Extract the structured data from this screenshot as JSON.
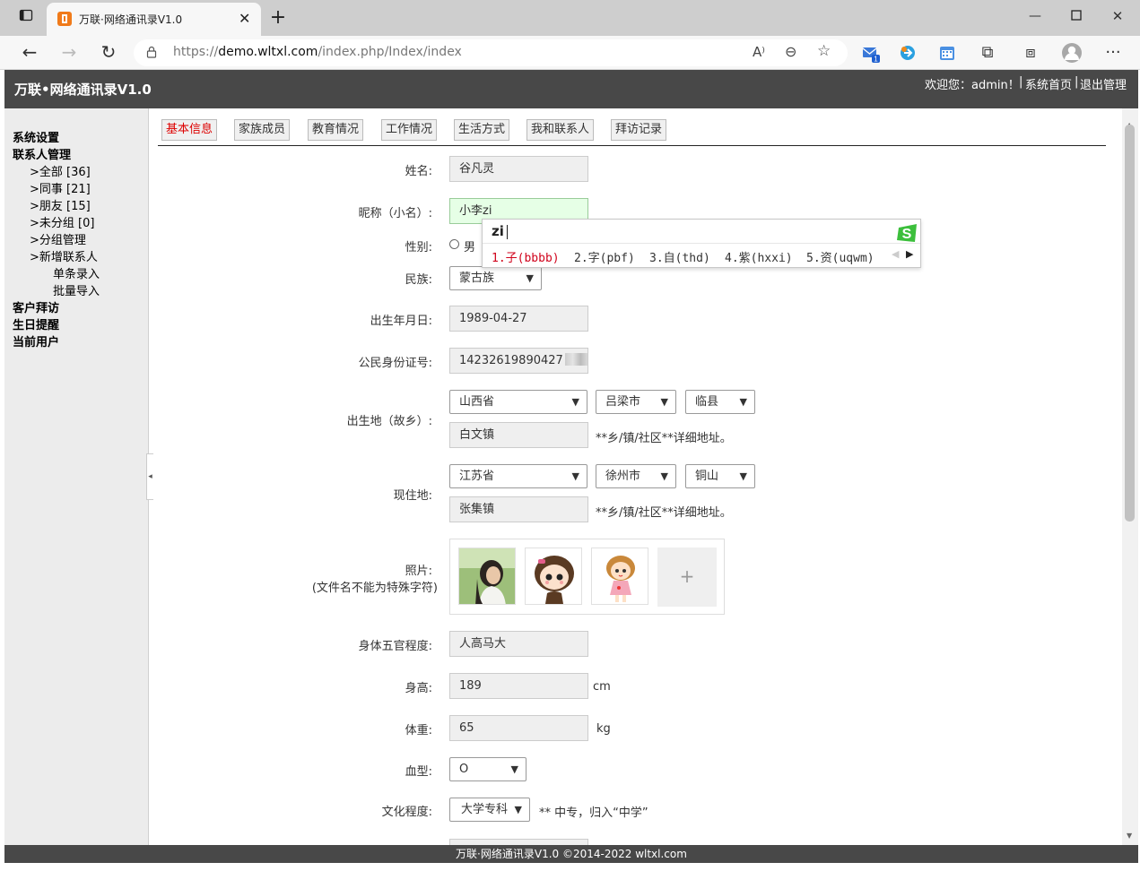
{
  "browser": {
    "tab_title": "万联·网络通讯录V1.0",
    "url_prefix": "https://",
    "url_domain": "demo.wltxl.com",
    "url_path": "/index.php/Index/index"
  },
  "app": {
    "title": "万联•网络通讯录V1.0",
    "welcome": "欢迎您：admin！",
    "home_link": "系统首页",
    "logout_link": "退出管理"
  },
  "sidebar": {
    "system": "系统设置",
    "contacts": "联系人管理",
    "all": ">全部 [36]",
    "colleagues": ">同事 [21]",
    "friends": ">朋友 [15]",
    "ungrouped": ">未分组 [0]",
    "groups": ">分组管理",
    "add": ">新增联系人",
    "single": "单条录入",
    "batch": "批量导入",
    "visits": "客户拜访",
    "birthdays": "生日提醒",
    "current_user": "当前用户"
  },
  "tabs": [
    "基本信息",
    "家族成员",
    "教育情况",
    "工作情况",
    "生活方式",
    "我和联系人",
    "拜访记录"
  ],
  "form": {
    "name_label": "姓名:",
    "name_value": "谷凡灵",
    "nickname_label": "昵称（小名）:",
    "nickname_value": "小李zi",
    "gender_label": "性别:",
    "gender_male": "男",
    "ethnicity_label": "民族:",
    "ethnicity_value": "蒙古族",
    "birthday_label": "出生年月日:",
    "birthday_value": "1989-04-27",
    "idcard_label": "公民身份证号:",
    "idcard_value": "14232619890427",
    "birthplace_label": "出生地（故乡）:",
    "birth_province": "山西省",
    "birth_city": "吕梁市",
    "birth_county": "临县",
    "birth_town": "白文镇",
    "address_note": "**乡/镇/社区**详细地址。",
    "residence_label": "现住地:",
    "res_province": "江苏省",
    "res_city": "徐州市",
    "res_county": "铜山",
    "res_town": "张集镇",
    "photo_label": "照片:",
    "photo_hint": "(文件名不能为特殊字符)",
    "photo_add": "+",
    "features_label": "身体五官程度:",
    "features_value": "人高马大",
    "height_label": "身高:",
    "height_value": "189",
    "height_unit": "cm",
    "weight_label": "体重:",
    "weight_value": "65",
    "weight_unit": "kg",
    "blood_label": "血型:",
    "blood_value": "O",
    "education_label": "文化程度:",
    "education_value": "大学专科",
    "education_note": "** 中专，归入“中学”"
  },
  "ime": {
    "input": "zi",
    "candidates": [
      "1.子(bbbb)",
      "2.字(pbf)",
      "3.自(thd)",
      "4.紫(hxxi)",
      "5.资(uqwm)"
    ]
  },
  "footer": "万联·网络通讯录V1.0 ©2014-2022 wltxl.com"
}
